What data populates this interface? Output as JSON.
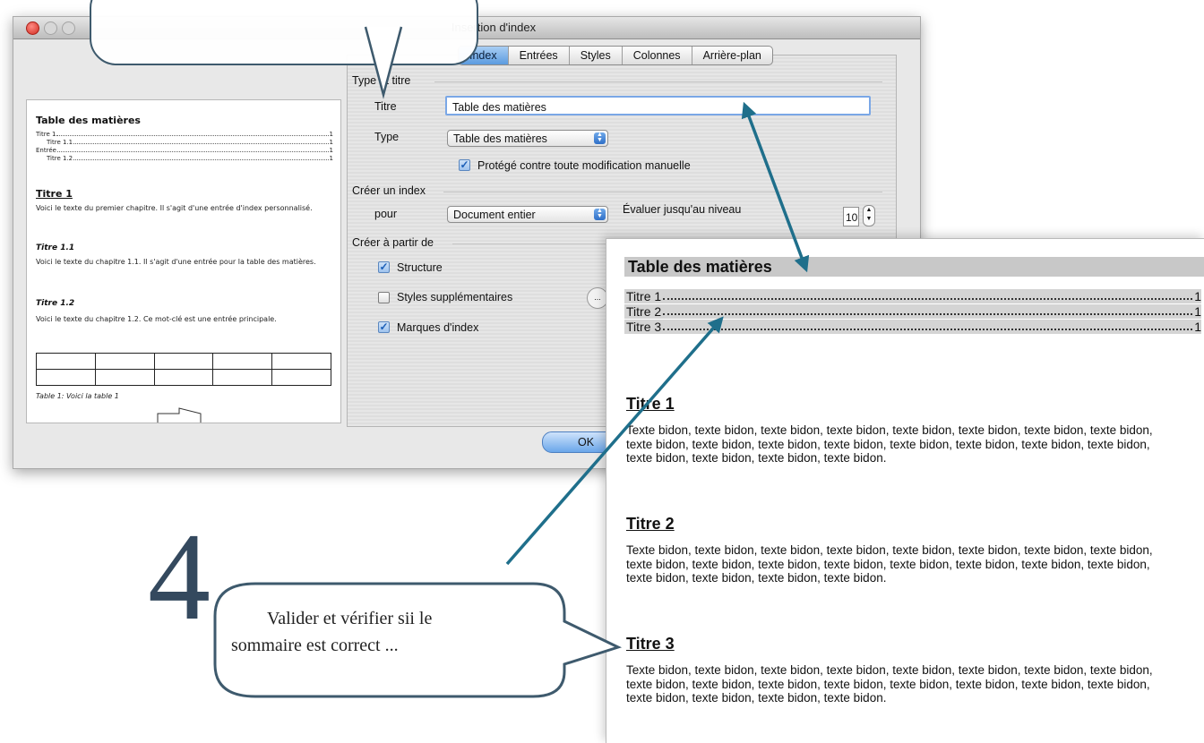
{
  "dialog": {
    "title": "Insertion d'index",
    "tabs": [
      {
        "label": "Index",
        "active": true
      },
      {
        "label": "Entrées",
        "active": false
      },
      {
        "label": "Styles",
        "active": false
      },
      {
        "label": "Colonnes",
        "active": false
      },
      {
        "label": "Arrière-plan",
        "active": false
      }
    ],
    "section_type_title": "Type et titre",
    "titre_label": "Titre",
    "titre_value": "Table des matières",
    "type_label": "Type",
    "type_value": "Table des matières",
    "protect_label": "Protégé contre toute modification manuelle",
    "protect_checked": true,
    "section_create": "Créer un index",
    "pour_label": "pour",
    "pour_value": "Document entier",
    "eval_label": "Évaluer jusqu'au niveau",
    "eval_value": "10",
    "section_from": "Créer à partir de",
    "structure_label": "Structure",
    "structure_checked": true,
    "styles_sup_label": "Styles supplémentaires",
    "styles_sup_checked": false,
    "styles_sup_button": "...",
    "marques_label": "Marques d'index",
    "marques_checked": true,
    "ok_label": "OK"
  },
  "preview": {
    "toc_title": "Table des matières",
    "toc_entries": [
      {
        "text": "Titre 1",
        "page": "1"
      },
      {
        "text": "Titre 1.1",
        "page": "1"
      },
      {
        "text": "Entrée",
        "page": "1"
      },
      {
        "text": "Titre 1.2",
        "page": "1"
      }
    ],
    "h1": "Titre 1",
    "p1": "Voici le texte du premier chapitre. Il s'agit d'une entrée d'index personnalisé.",
    "h11": "Titre 1.1",
    "p11": "Voici le texte du chapitre 1.1. Il s'agit d'une entrée pour la table des matières.",
    "h12": "Titre 1.2",
    "p12": "Voici le texte du chapitre 1.2. Ce mot-clé est une entrée principale.",
    "table_caption": "Table 1: Voici la table 1"
  },
  "document": {
    "toc_title": "Table des matières",
    "toc_entries": [
      {
        "text": "Titre 1",
        "page": "1"
      },
      {
        "text": "Titre 2",
        "page": "1"
      },
      {
        "text": "Titre 3",
        "page": "1"
      }
    ],
    "sections": [
      {
        "heading": "Titre 1",
        "body": "Texte bidon, texte bidon, texte bidon, texte bidon, texte bidon, texte bidon, texte bidon, texte bidon, texte bidon, texte bidon, texte bidon, texte bidon, texte bidon, texte bidon, texte bidon, texte bidon, texte bidon, texte bidon, texte bidon, texte bidon."
      },
      {
        "heading": "Titre 2",
        "body": "Texte bidon, texte bidon, texte bidon, texte bidon, texte bidon, texte bidon, texte bidon, texte bidon, texte bidon, texte bidon, texte bidon, texte bidon, texte bidon, texte bidon, texte bidon, texte bidon, texte bidon, texte bidon, texte bidon, texte bidon."
      },
      {
        "heading": "Titre 3",
        "body": "Texte bidon, texte bidon, texte bidon, texte bidon, texte bidon, texte bidon, texte bidon, texte bidon, texte bidon, texte bidon, texte bidon, texte bidon, texte bidon, texte bidon, texte bidon, texte bidon, texte bidon, texte bidon, texte bidon, texte bidon."
      }
    ]
  },
  "annotation": {
    "step_number": "4",
    "bubble_line1": "Valider et vérifier sii le",
    "bubble_line2": "sommaire est correct ...",
    "arrow_color": "#1f6f8b",
    "bubble_color": "#3e5a6d"
  }
}
